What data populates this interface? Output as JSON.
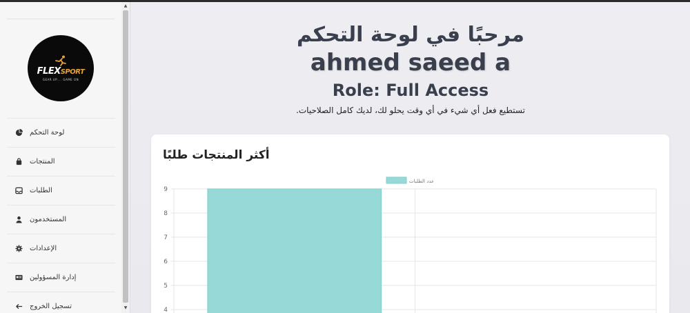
{
  "sidebar": {
    "logo": {
      "brand_main": "FLEX",
      "brand_accent": "SPORT",
      "tagline": "GEAR UP.... GAME ON"
    },
    "items": [
      {
        "label": "لوحة التحكم",
        "icon": "pie-chart-icon"
      },
      {
        "label": "المنتجات",
        "icon": "bag-icon"
      },
      {
        "label": "الطلبات",
        "icon": "inbox-icon"
      },
      {
        "label": "المستخدمون",
        "icon": "user-icon"
      },
      {
        "label": "الإعدادات",
        "icon": "gear-icon"
      },
      {
        "label": "إدارة المسؤولين",
        "icon": "id-card-icon"
      },
      {
        "label": "تسجيل الخروج",
        "icon": "arrow-left-icon"
      }
    ]
  },
  "header": {
    "welcome": "مرحبًا في لوحة التحكم",
    "username": "ahmed saeed a",
    "role": "Role: Full Access",
    "tagline": "تستطيع فعل أي شيء في أي وقت يحلو لك، لديك كامل الصلاحيات."
  },
  "card": {
    "title": "أكثر المنتجات طلبًا"
  },
  "colors": {
    "bar_fill": "#96d9d6",
    "bar_stroke": "#7fcfcb",
    "heading": "#3a3f4e"
  },
  "chart_data": {
    "type": "bar",
    "categories": [
      "",
      ""
    ],
    "series": [
      {
        "name": "عدد الطلبات",
        "values": [
          9,
          null
        ]
      }
    ],
    "ylim": [
      4,
      9
    ],
    "yticks": [
      4,
      5,
      6,
      7,
      8,
      9
    ],
    "legend": "top-center",
    "grid": true
  }
}
